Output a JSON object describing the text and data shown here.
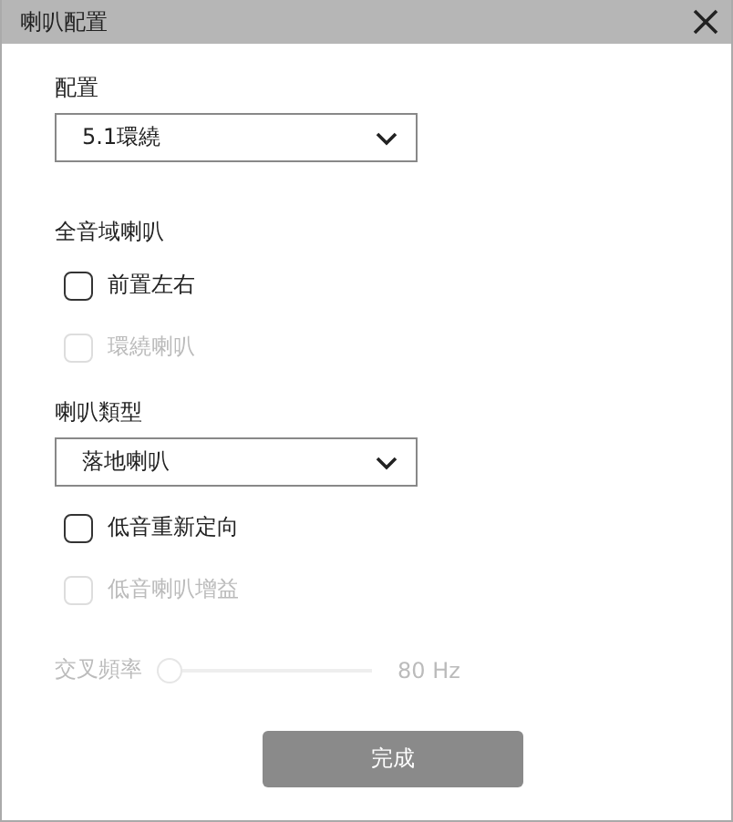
{
  "window": {
    "title": "喇叭配置"
  },
  "items": [
    {
      "kind": "label",
      "text": "配置"
    },
    {
      "kind": "select",
      "value": "5.1環繞"
    },
    {
      "kind": "heading",
      "text": "全音域喇叭"
    },
    {
      "kind": "checkbox",
      "label": "前置左右",
      "checked": false,
      "disabled": false
    },
    {
      "kind": "checkbox",
      "label": "環繞喇叭",
      "checked": false,
      "disabled": true
    },
    {
      "kind": "label",
      "text": "喇叭類型"
    },
    {
      "kind": "select",
      "value": "落地喇叭"
    },
    {
      "kind": "checkbox",
      "label": "低音重新定向",
      "checked": false,
      "disabled": false
    },
    {
      "kind": "checkbox",
      "label": "低音喇叭增益",
      "checked": false,
      "disabled": true
    },
    {
      "kind": "slider",
      "label": "交叉頻率",
      "level": 0,
      "reading": "80 Hz",
      "disabled": true
    }
  ],
  "buttons": [
    {
      "label": "完成"
    }
  ]
}
